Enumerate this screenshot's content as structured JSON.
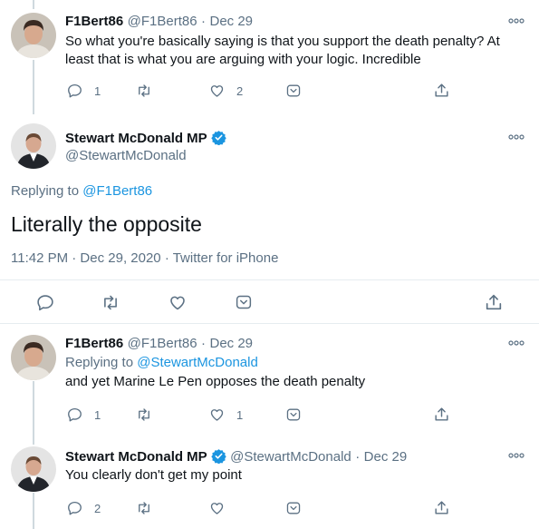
{
  "tweets": [
    {
      "name": "F1Bert86",
      "handle": "@F1Bert86",
      "sep": "·",
      "date": "Dec 29",
      "text_line1": "So what you're basically saying is that you support the death penalty? At",
      "text_line2": "least that is what you are arguing with your logic. Incredible",
      "replies": "1",
      "likes": "2"
    },
    {
      "name": "F1Bert86",
      "handle": "@F1Bert86",
      "sep": "·",
      "date": "Dec 29",
      "replying_prefix": "Replying to",
      "replying_to": "@StewartMcDonald",
      "text": "and yet Marine Le Pen opposes the death penalty",
      "replies": "1",
      "likes": "1"
    },
    {
      "name": "Stewart McDonald MP",
      "handle": "@StewartMcDonald",
      "sep": "·",
      "date": "Dec 29",
      "text": "You clearly don't get my point",
      "replies": "2"
    }
  ],
  "main_tweet": {
    "name": "Stewart McDonald MP",
    "handle": "@StewartMcDonald",
    "replying_prefix": "Replying to",
    "replying_to": "@F1Bert86",
    "text": "Literally the opposite",
    "timestamp": "11:42 PM · Dec 29, 2020 · Twitter for iPhone"
  },
  "icons": {
    "reply": "reply-icon",
    "retweet": "retweet-icon",
    "like": "heart-icon",
    "bookmark": "bookmark-icon",
    "share": "share-icon",
    "more": "more-icon",
    "verified": "verified-badge-icon"
  },
  "colors": {
    "accent": "#1b95e0",
    "muted": "#5b7083",
    "text": "#0f1419",
    "divider": "#e6ecf0",
    "thread_line": "#cfd9de"
  }
}
